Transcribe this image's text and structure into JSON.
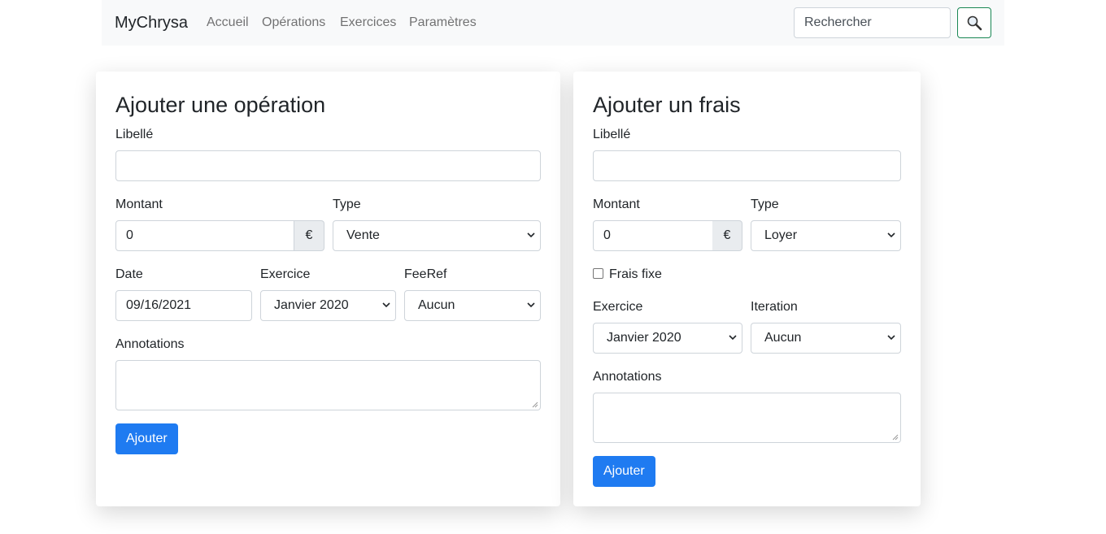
{
  "navbar": {
    "brand": "MyChrysa",
    "links": [
      "Accueil",
      "Opérations",
      "Exercices",
      "Paramètres"
    ],
    "search_placeholder": "Rechercher"
  },
  "operation_form": {
    "title": "Ajouter une opération",
    "libelle_label": "Libellé",
    "libelle_value": "",
    "montant_label": "Montant",
    "montant_value": "0",
    "currency": "€",
    "type_label": "Type",
    "type_value": "Vente",
    "date_label": "Date",
    "date_value": "09/16/2021",
    "exercice_label": "Exercice",
    "exercice_value": "Janvier 2020",
    "feeref_label": "FeeRef",
    "feeref_value": "Aucun",
    "annotations_label": "Annotations",
    "submit_label": "Ajouter"
  },
  "frais_form": {
    "title": "Ajouter un frais",
    "libelle_label": "Libellé",
    "libelle_value": "",
    "montant_label": "Montant",
    "montant_value": "0",
    "currency": "€",
    "type_label": "Type",
    "type_value": "Loyer",
    "frais_fixe_label": "Frais fixe",
    "frais_fixe_checked": false,
    "exercice_label": "Exercice",
    "exercice_value": "Janvier 2020",
    "iteration_label": "Iteration",
    "iteration_value": "Aucun",
    "annotations_label": "Annotations",
    "submit_label": "Ajouter"
  },
  "colors": {
    "navbar_bg": "#f8f9fa",
    "primary": "#1f7bf1",
    "search_button_border": "#198754"
  },
  "icons": {
    "search": "search-icon",
    "select_arrow": "chevron-down-icon"
  }
}
